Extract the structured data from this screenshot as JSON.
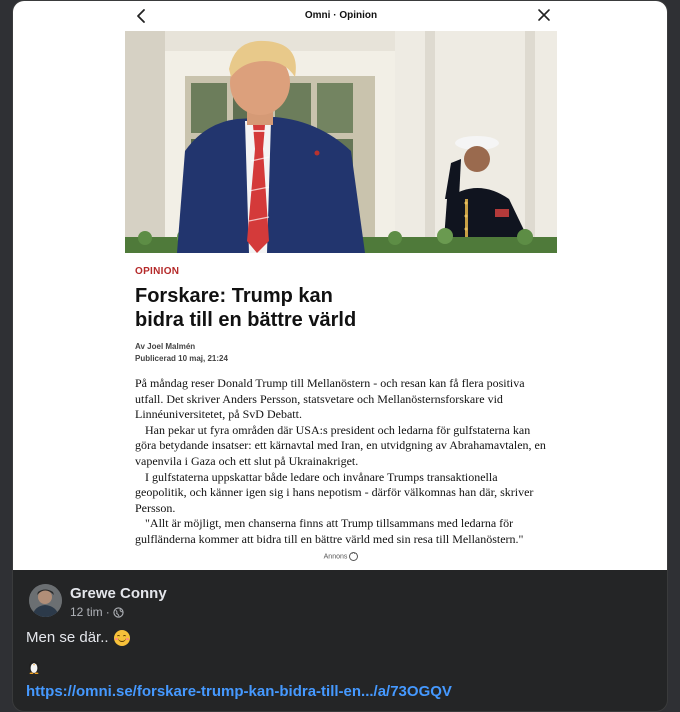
{
  "colors": {
    "post_background": "#242526",
    "link": "#4599ff",
    "kicker": "#b52a2a"
  },
  "screenshot": {
    "header_title": "Omni · Opinion",
    "back_icon": "chevron-left-icon",
    "close_icon": "close-icon",
    "article": {
      "kicker": "OPINION",
      "headline_line1": "Forskare: Trump kan",
      "headline_line2": "bidra till en bättre värld",
      "author": "Av Joel Malmén",
      "published": "Publicerad 10 maj, 21:24",
      "paragraphs": [
        "På måndag reser Donald Trump till Mellanöstern - och resan kan få flera positiva utfall. Det skriver Anders Persson, statsvetare och Mellanösternsforskare vid Linnéuniversitetet, på SvD Debatt.",
        "Han pekar ut fyra områden där USA:s president och ledarna för gulfstaterna kan göra betydande insatser: ett kärnavtal med Iran, en utvidgning av Abrahamavtalen, en vapenvila i Gaza och ett slut på Ukrainakriget.",
        "I gulfstaterna uppskattar både ledare och invånare Trumps transaktionella geopolitik, och känner igen sig i hans nepotism - därför välkomnas han där, skriver Persson.",
        "\"Allt är möjligt, men chanserna finns att Trump tillsammans med ledarna för gulfländerna kommer att bidra till en bättre värld med sin resa till Mellanöstern.\""
      ],
      "ad_label": "Annons"
    }
  },
  "post": {
    "author_name": "Grewe Conny",
    "time": "12 tim",
    "separator": "·",
    "audience_icon": "globe-icon",
    "text": "Men se där..",
    "emoji": "smiling-face-icon",
    "penguin": "penguin-icon",
    "link_text": "https://omni.se/forskare-trump-kan-bidra-till-en.../a/73OGQV"
  }
}
